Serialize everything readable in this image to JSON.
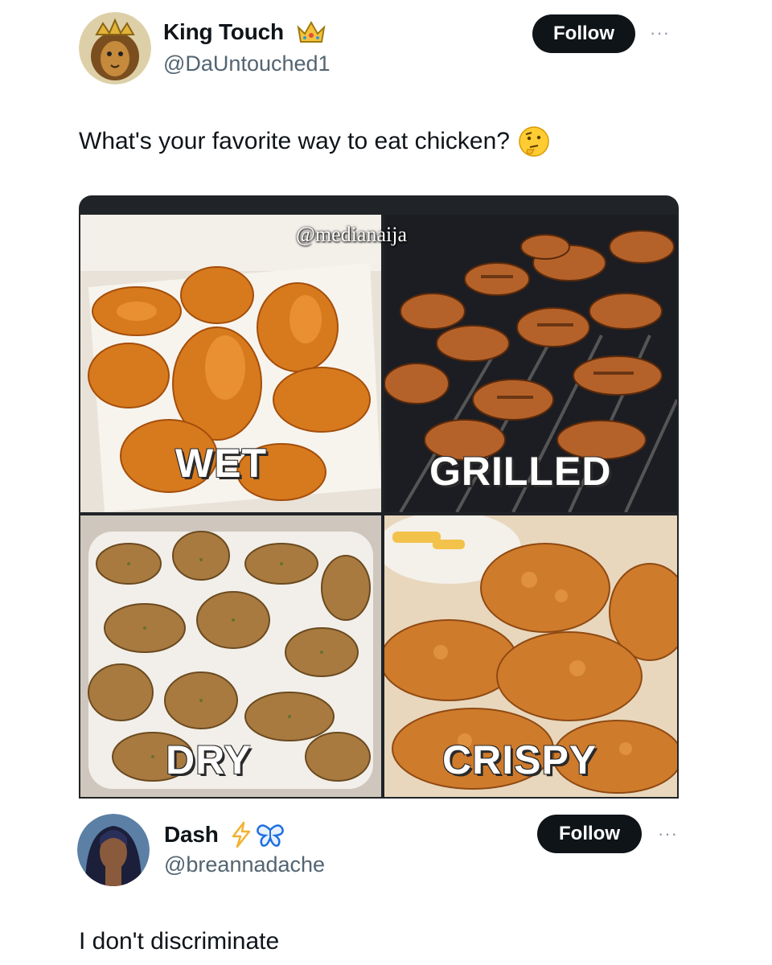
{
  "tweet": {
    "author_name": "King Touch",
    "author_badge_icon": "crown-icon",
    "author_handle": "@DaUntouched1",
    "follow_label": "Follow",
    "more_label": "···",
    "text": "What's your favorite way to eat chicken?",
    "text_emoji_icon": "thinking-face-icon"
  },
  "image": {
    "watermark": "@medianaija",
    "quadrants": [
      {
        "label": "WET"
      },
      {
        "label": "GRILLED"
      },
      {
        "label": "DRY"
      },
      {
        "label": "CRISPY"
      }
    ]
  },
  "reply": {
    "author_name": "Dash",
    "author_badges": [
      "lightning-icon",
      "butterfly-icon"
    ],
    "author_handle": "@breannadache",
    "follow_label": "Follow",
    "more_label": "···",
    "text": "I don't discriminate"
  },
  "colors": {
    "follow_bg": "#0f1419",
    "handle": "#536471",
    "accent_lightning": "#f2b233",
    "accent_butterfly": "#1d6fe0"
  }
}
